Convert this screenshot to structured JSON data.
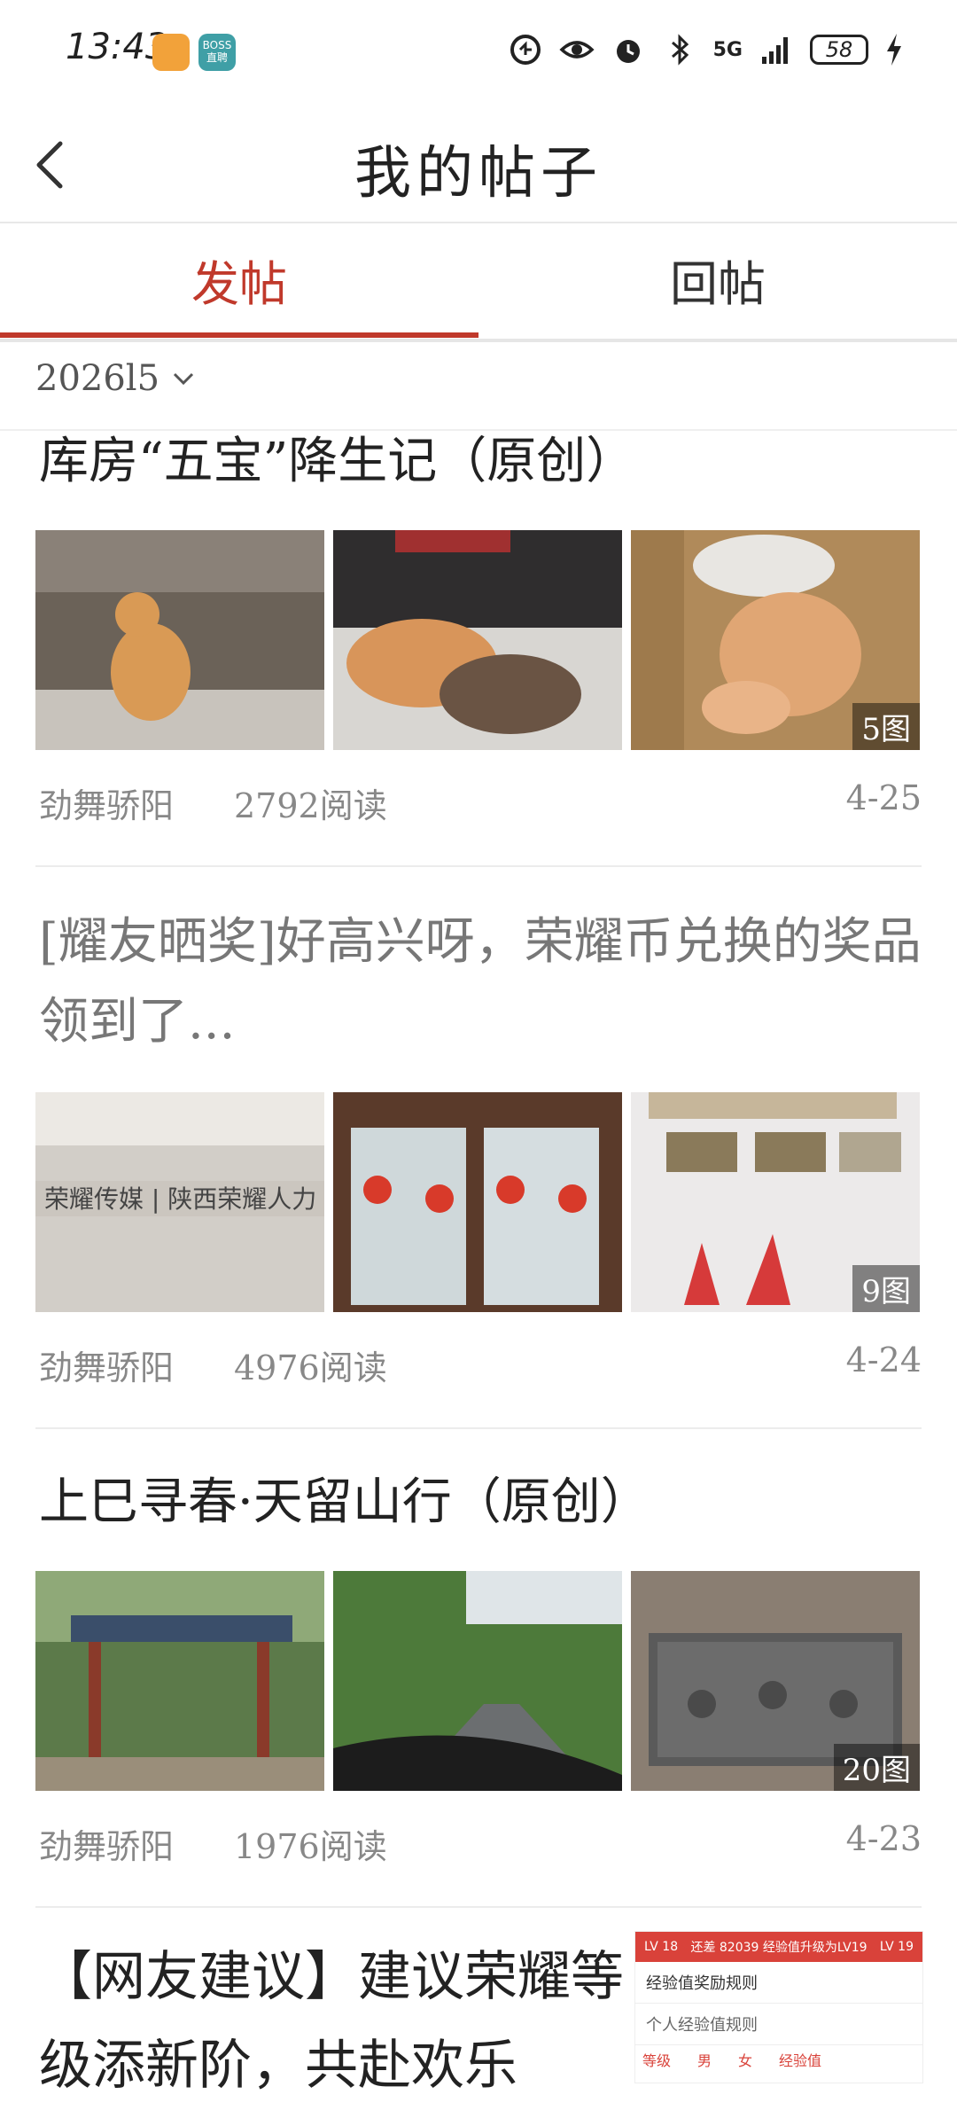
{
  "status_bar": {
    "time": "13:43",
    "boss_icon_text": "BOSS\n直聘",
    "network": "5G",
    "battery": "58"
  },
  "header": {
    "title": "我的帖子"
  },
  "tabs": [
    {
      "label": "发帖",
      "active": true
    },
    {
      "label": "回帖",
      "active": false
    }
  ],
  "filter": {
    "date": "2026l5"
  },
  "posts": [
    {
      "title": "库房“五宝”降生记（原创）",
      "image_count": "5图",
      "author": "劲舞骄阳",
      "reads": "2792阅读",
      "date": "4-25"
    },
    {
      "title": "[耀友晒奖]好高兴呀，荣耀币兑换的奖品领到了...",
      "image_count": "9图",
      "author": "劲舞骄阳",
      "reads": "4976阅读",
      "date": "4-24"
    },
    {
      "title": "上巳寻春·天留山行（原创）",
      "image_count": "20图",
      "author": "劲舞骄阳",
      "reads": "1976阅读",
      "date": "4-23"
    }
  ],
  "last_post": {
    "title": "【网友建议】建议荣耀等级添新阶，共赴欢乐",
    "side_card": {
      "top_left": "LV 18",
      "top_mid": "还差 82039 经验值升级为LV19",
      "top_right": "LV 19",
      "row1": "经验值奖励规则",
      "row2": "个人经验值规则",
      "col1": "等级",
      "col2": "男",
      "col3": "女",
      "col4": "经验值"
    }
  },
  "colors": {
    "accent": "#c0392b",
    "text": "#222222",
    "muted": "#888888"
  }
}
